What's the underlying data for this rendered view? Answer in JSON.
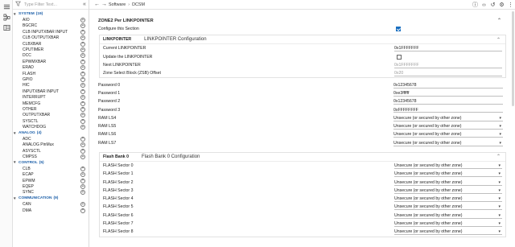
{
  "sidebar": {
    "filter_placeholder": "Type Filter Text...",
    "sections": [
      {
        "name": "SYSTEM",
        "count": "(19)",
        "items": [
          "AIO",
          "BGCRC",
          "CLB INPUTXBAR INPUT",
          "CLB OUTPUTXBAR",
          "CLBXBAR",
          "CPUTIMER",
          "DCC",
          "EPWMXBAR",
          "ERAD",
          "FLASH",
          "GPIO",
          "HIC",
          "INPUTXBAR INPUT",
          "INTERRUPT",
          "MEMCFG",
          "OTHER",
          "OUTPUTXBAR",
          "SYSCTL",
          "WATCHDOG"
        ]
      },
      {
        "name": "ANALOG",
        "count": "(4)",
        "items": [
          "ADC",
          "ANALOG PinMux",
          "ASYSCTL",
          "CMPSS"
        ]
      },
      {
        "name": "CONTROL",
        "count": "(5)",
        "items": [
          "CLB",
          "ECAP",
          "EPWM",
          "EQEP",
          "SYNC"
        ]
      },
      {
        "name": "COMMUNICATION",
        "count": "(9)",
        "items": [
          "CAN",
          "DMA"
        ]
      }
    ]
  },
  "breadcrumb": {
    "parent": "Software",
    "current": "DCSM"
  },
  "zone": {
    "title": "ZONE2 Per LINKPOINTER",
    "configure_label": "Configure this Section",
    "configure_checked": true,
    "linkpointer": {
      "tag": "LINKPOINTER",
      "title": "LINKPOINTER Configuration",
      "rows": [
        {
          "label": "Current LINKPOINTER",
          "type": "text",
          "value": "0x1FFFFFFF"
        },
        {
          "label": "Update the LINKPOINTER",
          "type": "checkbox",
          "checked": false
        },
        {
          "label": "Next LINKPOINTER",
          "type": "text",
          "value": "0x1FFFFFFF",
          "dim": true
        },
        {
          "label": "Zone Select Block (ZSB) Offset",
          "type": "text",
          "value": "0x20",
          "dim": true
        }
      ]
    },
    "fields": [
      {
        "label": "Password 0",
        "type": "text",
        "value": "0x12345678"
      },
      {
        "label": "Password 1",
        "type": "text",
        "value": "0xe3ffffff"
      },
      {
        "label": "Password 2",
        "type": "text",
        "value": "0x12345678"
      },
      {
        "label": "Password 3",
        "type": "text",
        "value": "0xFFFFFFFF"
      },
      {
        "label": "RAM LS4",
        "type": "select",
        "value": "Unsecure (or secured by other zone)"
      },
      {
        "label": "RAM LS5",
        "type": "select",
        "value": "Unsecure (or secured by other zone)"
      },
      {
        "label": "RAM LS6",
        "type": "select",
        "value": "Unsecure (or secured by other zone)"
      },
      {
        "label": "RAM LS7",
        "type": "select",
        "value": "Unsecure (or secured by other zone)"
      }
    ],
    "flash": {
      "tag": "Flash Bank 0",
      "title": "Flash Bank 0 Configuration",
      "rows": [
        {
          "label": "FLASH Sector 0",
          "value": "Unsecure (or secured by other zone)"
        },
        {
          "label": "FLASH Sector 1",
          "value": "Unsecure (or secured by other zone)"
        },
        {
          "label": "FLASH Sector 2",
          "value": "Unsecure (or secured by other zone)"
        },
        {
          "label": "FLASH Sector 3",
          "value": "Unsecure (or secured by other zone)"
        },
        {
          "label": "FLASH Sector 4",
          "value": "Unsecure (or secured by other zone)"
        },
        {
          "label": "FLASH Sector 5",
          "value": "Unsecure (or secured by other zone)"
        },
        {
          "label": "FLASH Sector 6",
          "value": "Unsecure (or secured by other zone)"
        },
        {
          "label": "FLASH Sector 7",
          "value": "Unsecure (or secured by other zone)"
        },
        {
          "label": "FLASH Sector 8",
          "value": "Unsecure (or secured by other zone)"
        }
      ]
    }
  },
  "colors": {
    "accent": "#1a6fc0",
    "section_header": "#1a5ea8"
  }
}
